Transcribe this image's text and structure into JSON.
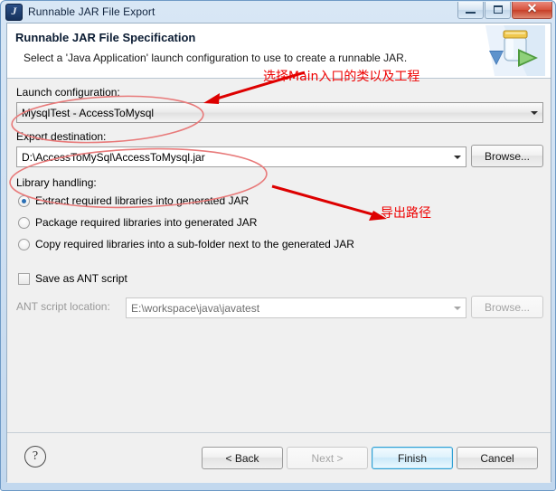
{
  "window": {
    "title": "Runnable JAR File Export",
    "icon": "jar-export-icon",
    "buttons": {
      "minimize": "minimize-button",
      "maximize": "maximize-button",
      "close": "✕"
    }
  },
  "header": {
    "title": "Runnable JAR File Specification",
    "description": "Select a 'Java Application' launch configuration to use to create a runnable JAR.",
    "icon": "jar-wizard-banner-icon"
  },
  "form": {
    "launch_configuration": {
      "label": "Launch configuration:",
      "value": "MysqlTest - AccessToMysql"
    },
    "export_destination": {
      "label": "Export destination:",
      "value": "D:\\AccessToMySql\\AccessToMysql.jar",
      "browse_label": "Browse..."
    },
    "library_handling": {
      "label": "Library handling:",
      "options": [
        {
          "label": "Extract required libraries into generated JAR",
          "selected": true
        },
        {
          "label": "Package required libraries into generated JAR",
          "selected": false
        },
        {
          "label": "Copy required libraries into a sub-folder next to the generated JAR",
          "selected": false
        }
      ]
    },
    "ant_script": {
      "checkbox_label": "Save as ANT script",
      "checked": false,
      "location_label": "ANT script location:",
      "location_value": "E:\\workspace\\java\\javatest",
      "browse_label": "Browse...",
      "enabled": false
    }
  },
  "buttonbar": {
    "help": "?",
    "back": "< Back",
    "next": "Next >",
    "finish": "Finish",
    "cancel": "Cancel"
  },
  "annotations": [
    {
      "text": "选择Main入口的类以及工程",
      "name": "annotation-select-main-class"
    },
    {
      "text": "导出路径",
      "name": "annotation-export-path"
    }
  ],
  "colors": {
    "annotation": "#ee0000",
    "default_button_accent": "#2e9fd4",
    "radio_dot": "#2a6fb5",
    "title_bar": "#cfe0f2"
  }
}
